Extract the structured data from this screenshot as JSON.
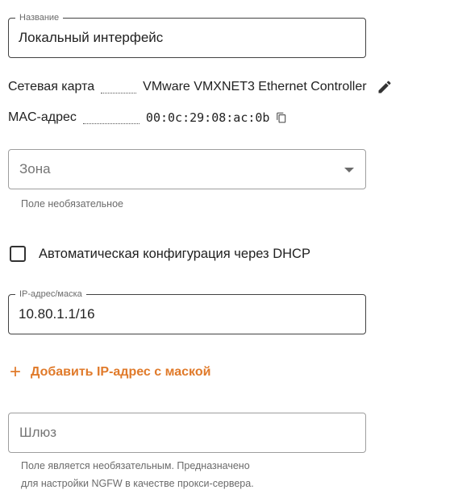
{
  "interface_name": {
    "legend": "Название",
    "value": "Локальный интерфейс"
  },
  "network_card": {
    "label": "Сетевая карта",
    "value": "VMware VMXNET3 Ethernet Controller",
    "edit_icon": "pencil-icon"
  },
  "mac_address": {
    "label": "MAC-адрес",
    "value": "00:0c:29:08:ac:0b",
    "copy_icon": "copy-icon"
  },
  "zone": {
    "placeholder": "Зона",
    "hint": "Поле необязательное"
  },
  "dhcp": {
    "label": "Автоматическая конфигурация через DHCP",
    "checked": false
  },
  "ip_mask": {
    "legend": "IP-адрес/маска",
    "value": "10.80.1.1/16"
  },
  "add_ip": {
    "icon": "+",
    "label": "Добавить IP-адрес с маской"
  },
  "gateway": {
    "placeholder": "Шлюз",
    "hint_line1": "Поле является необязательным. Предназначено",
    "hint_line2": "для настройки NGFW в качестве прокси-сервера."
  },
  "colors": {
    "accent": "#e07a2a",
    "border": "#424242",
    "hint": "#6b6b6b"
  }
}
